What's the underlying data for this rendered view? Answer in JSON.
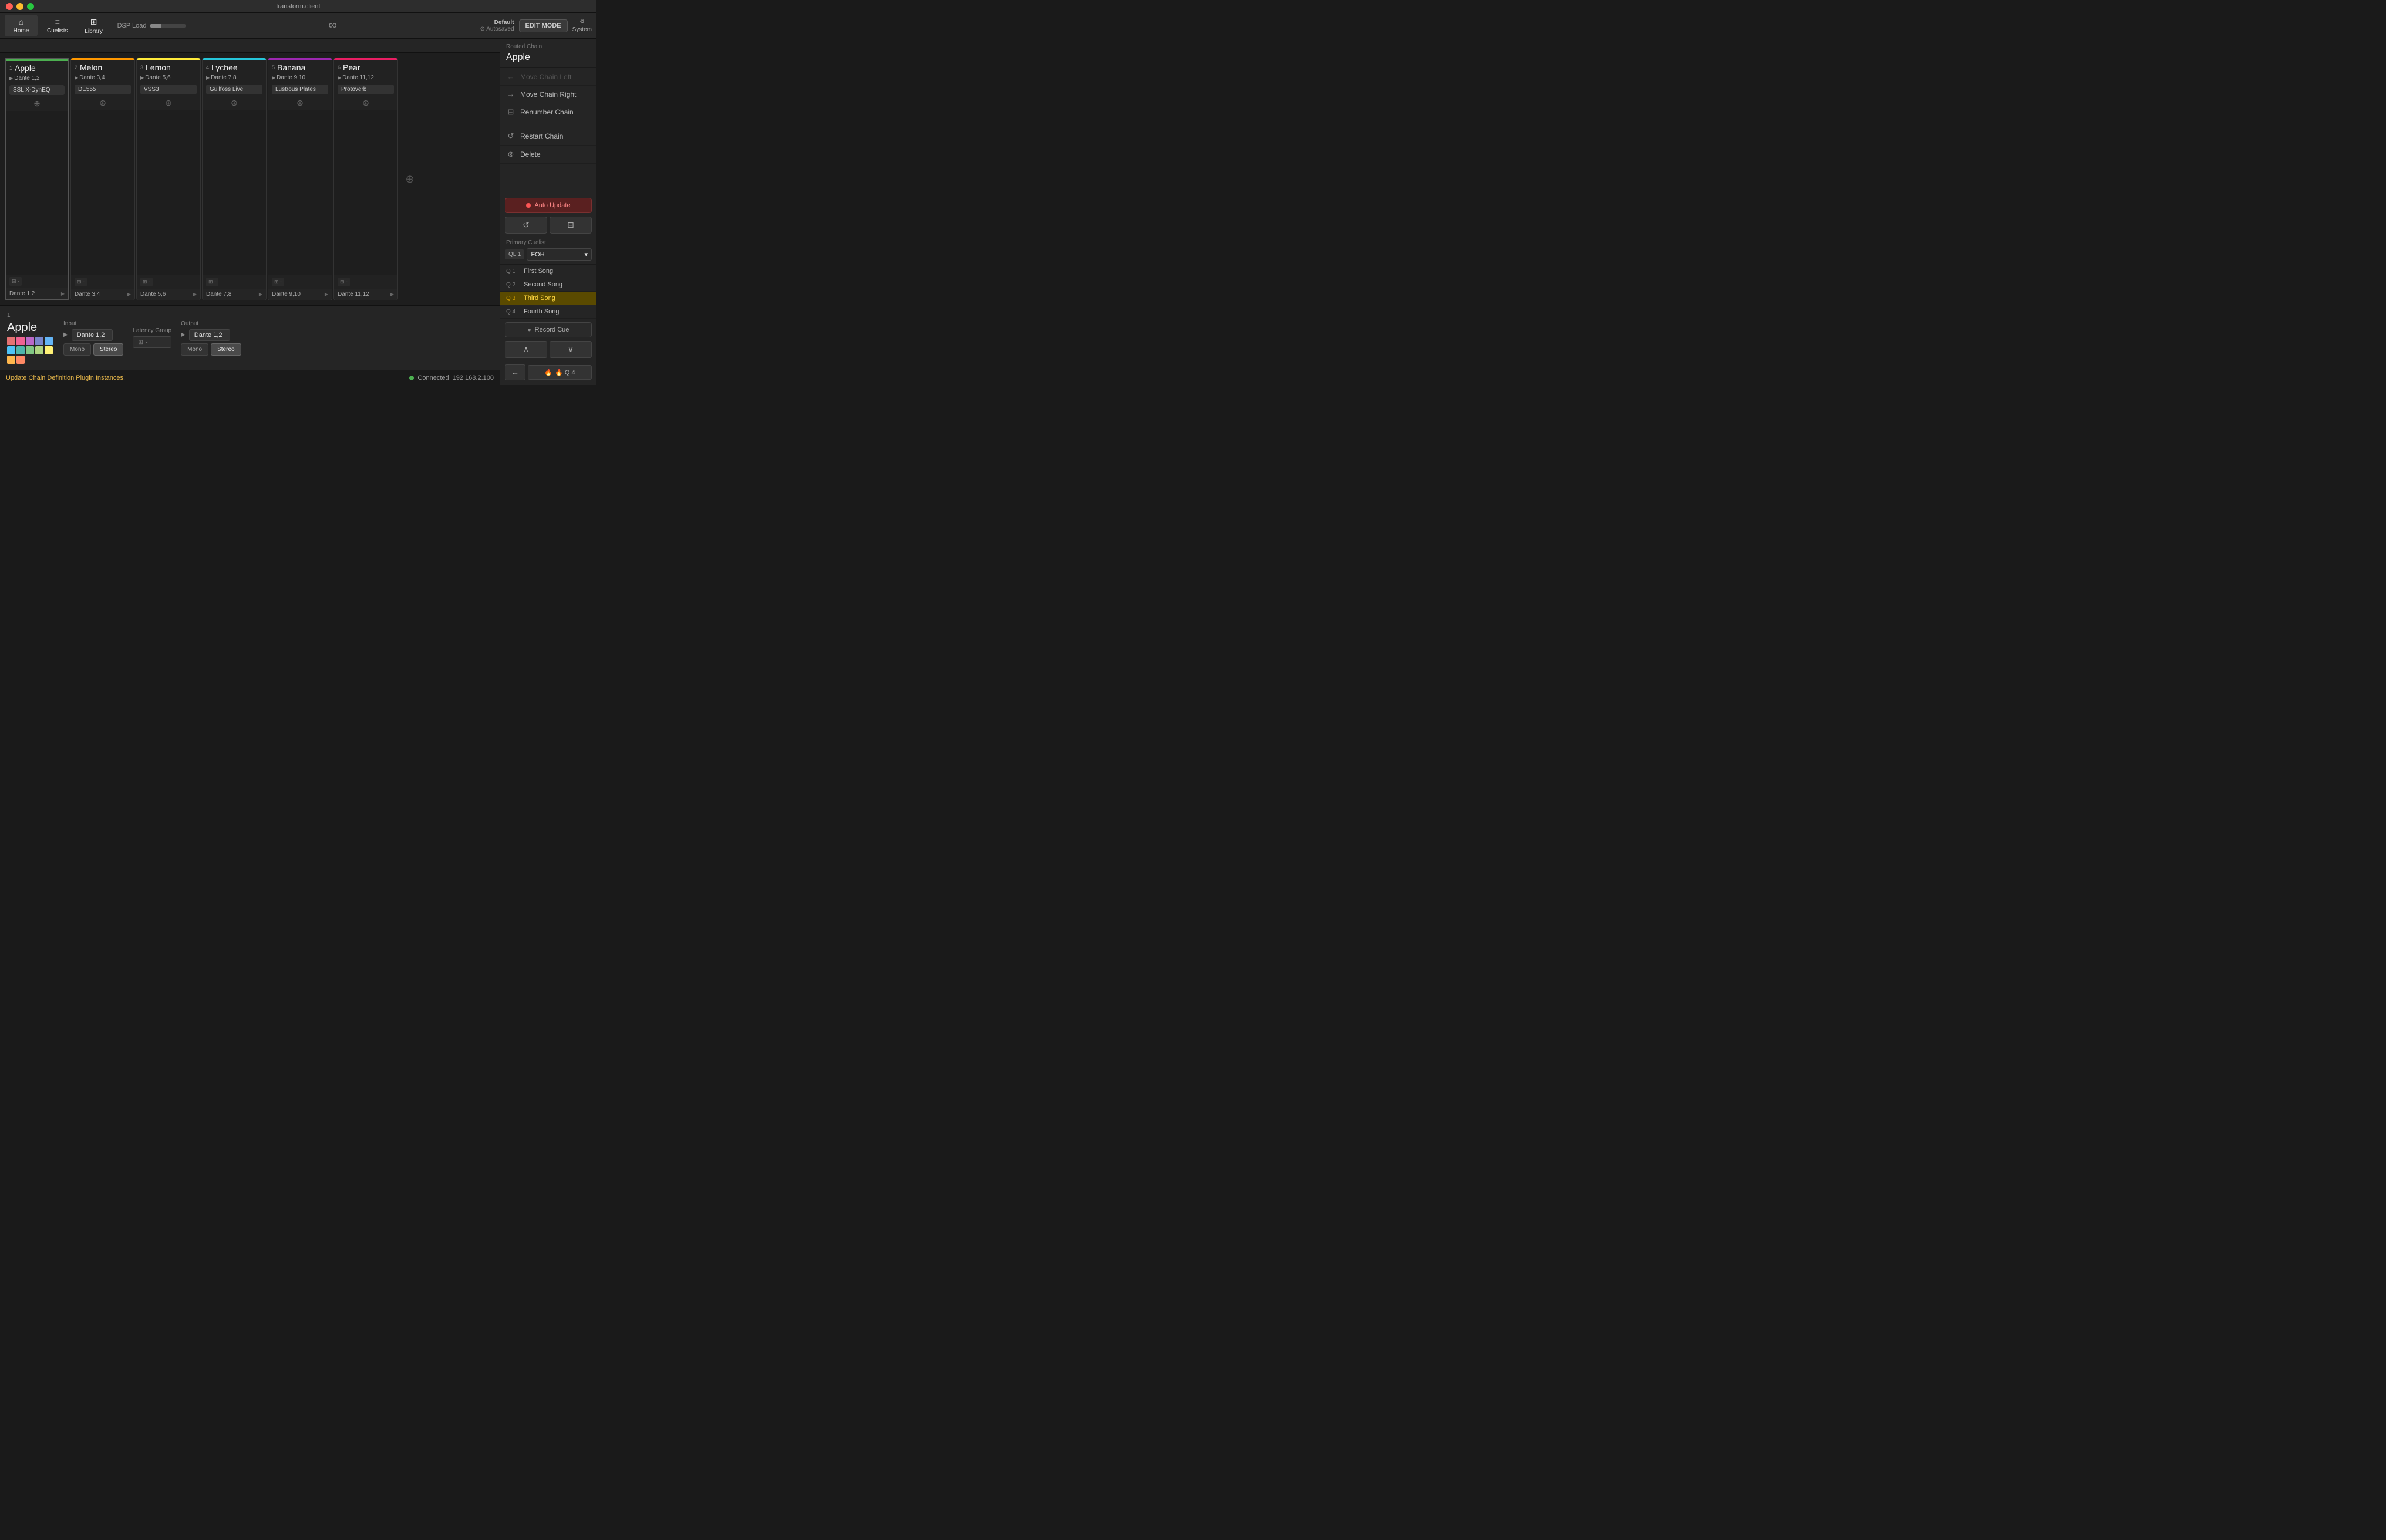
{
  "window": {
    "title": "transform.client"
  },
  "toolbar": {
    "home_label": "Home",
    "cuelists_label": "Cuelists",
    "library_label": "Library",
    "dsp_load_label": "DSP Load",
    "edit_mode_label": "EDIT MODE",
    "autosaved_label": "Default",
    "autosaved_sub": "⊘ Autosaved",
    "system_label": "System"
  },
  "chains": [
    {
      "number": "1",
      "name": "Apple",
      "dante": "Dante 1,2",
      "plugin": "SSL X-DynEQ",
      "color": "green",
      "output": "Dante 1,2",
      "selected": true
    },
    {
      "number": "2",
      "name": "Melon",
      "dante": "Dante 3,4",
      "plugin": "DE555",
      "color": "orange",
      "output": "Dante 3,4",
      "selected": false
    },
    {
      "number": "3",
      "name": "Lemon",
      "dante": "Dante 5,6",
      "plugin": "VSS3",
      "color": "yellow",
      "output": "Dante 5,6",
      "selected": false
    },
    {
      "number": "4",
      "name": "Lychee",
      "dante": "Dante 7,8",
      "plugin": "Gullfoss Live",
      "color": "teal",
      "output": "Dante 7,8",
      "selected": false
    },
    {
      "number": "5",
      "name": "Banana",
      "dante": "Dante 9,10",
      "plugin": "Lustrous Plates",
      "color": "purple",
      "output": "Dante 9,10",
      "selected": false
    },
    {
      "number": "6",
      "name": "Pear",
      "dante": "Dante 11,12",
      "plugin": "Protoverb",
      "color": "pink",
      "output": "Dante 11,12",
      "selected": false
    }
  ],
  "right_panel": {
    "routed_chain_label": "Routed Chain",
    "chain_name": "Apple",
    "move_chain_left": "Move Chain Left",
    "move_chain_right": "Move Chain Right",
    "renumber_chain": "Renumber Chain",
    "restart_chain": "Restart Chain",
    "delete": "Delete",
    "auto_update": "Auto Update",
    "primary_cuelist_label": "Primary Cuelist",
    "ql_badge": "QL 1",
    "ql_name": "FOH",
    "cues": [
      {
        "badge": "Q 1",
        "name": "First Song",
        "active": false
      },
      {
        "badge": "Q 2",
        "name": "Second Song",
        "active": false
      },
      {
        "badge": "Q 3",
        "name": "Third Song",
        "active": true
      },
      {
        "badge": "Q 4",
        "name": "Fourth Song",
        "active": false
      }
    ],
    "record_cue": "Record Cue",
    "fire_label": "🔥 Q 4",
    "back_label": "←"
  },
  "bottom_panel": {
    "chain_num": "1",
    "chain_name": "Apple",
    "input_label": "Input",
    "input_value": "Dante 1,2",
    "latency_label": "Latency Group",
    "latency_value": "-",
    "output_label": "Output",
    "output_value": "Dante 1,2",
    "mono_label": "Mono",
    "stereo_label": "Stereo"
  },
  "status_bar": {
    "message": "Update Chain Definition Plugin Instances!",
    "connected_label": "Connected",
    "ip_address": "192.168.2.100"
  },
  "swatches": [
    "#e57373",
    "#f06292",
    "#ba68c8",
    "#7986cb",
    "#64b5f6",
    "#4fc3f7",
    "#4db6ac",
    "#81c784",
    "#aed581",
    "#fff176",
    "#ffb74d",
    "#ff8a65"
  ]
}
